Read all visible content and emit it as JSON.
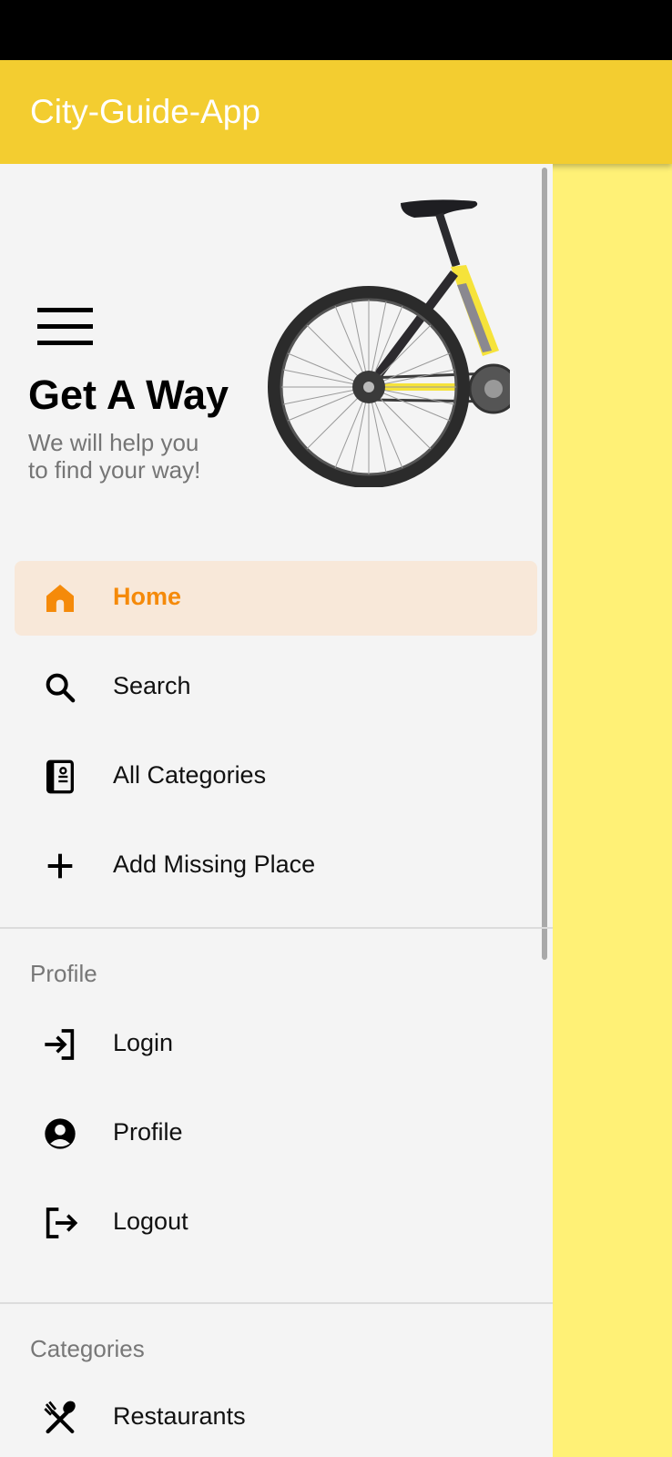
{
  "app": {
    "title": "City-Guide-App"
  },
  "colors": {
    "app_bar": "#f3cd30",
    "scrim": "#fff176",
    "drawer_bg": "#f4f4f4",
    "active_bg": "#f8e8d9",
    "active_text": "#f58a0a"
  },
  "header": {
    "title": "Get A Way",
    "subtitle_line1": "We will help you",
    "subtitle_line2": "to find your way!"
  },
  "nav": {
    "items": [
      {
        "label": "Home",
        "icon": "home-icon",
        "active": true
      },
      {
        "label": "Search",
        "icon": "search-icon",
        "active": false
      },
      {
        "label": "All Categories",
        "icon": "book-icon",
        "active": false
      },
      {
        "label": "Add Missing Place",
        "icon": "plus-icon",
        "active": false
      }
    ]
  },
  "profile_section": {
    "heading": "Profile",
    "items": [
      {
        "label": "Login",
        "icon": "login-icon"
      },
      {
        "label": "Profile",
        "icon": "account-circle-icon"
      },
      {
        "label": "Logout",
        "icon": "logout-icon"
      }
    ]
  },
  "categories_section": {
    "heading": "Categories",
    "items": [
      {
        "label": "Restaurants",
        "icon": "restaurant-icon"
      }
    ]
  }
}
